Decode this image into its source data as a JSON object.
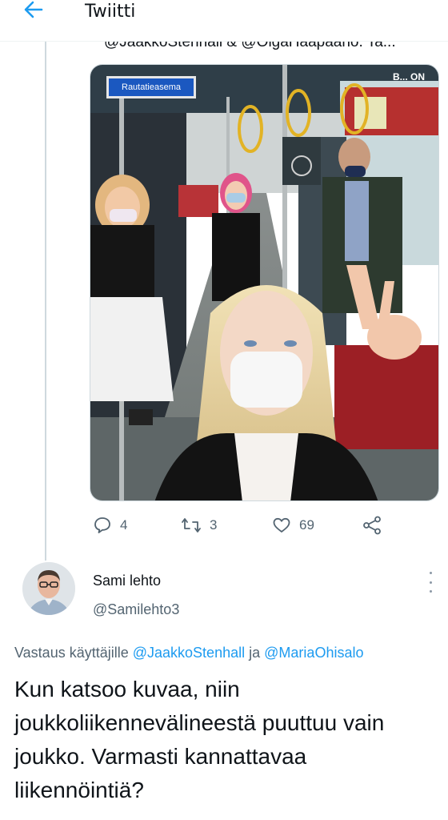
{
  "header": {
    "title": "Twiitti",
    "back_icon": "arrow-left-icon",
    "accent_color": "#1d9bf0"
  },
  "quoted": {
    "text": "@JaakkoStenhall & @OlgaHaapaano. Ta..."
  },
  "photo": {
    "tram_sign": "Rautatieasema",
    "store_sign": "B... ON"
  },
  "tweet_actions": {
    "replies": "4",
    "retweets": "3",
    "likes": "69",
    "icons": [
      "reply-icon",
      "retweet-icon",
      "like-icon",
      "share-icon"
    ]
  },
  "reply": {
    "display_name": "Sami lehto",
    "handle": "@Samilehto3",
    "reply_prefix": "Vastaus käyttäjille",
    "mention_1": "@JaakkoStenhall",
    "conjunction": "ja",
    "mention_2": "@MariaOhisalo",
    "body": "Kun katsoo kuvaa, niin joukkoliikennevälineestä puuttuu vain joukko. Varmasti kannattavaa liikennöintiä?"
  }
}
